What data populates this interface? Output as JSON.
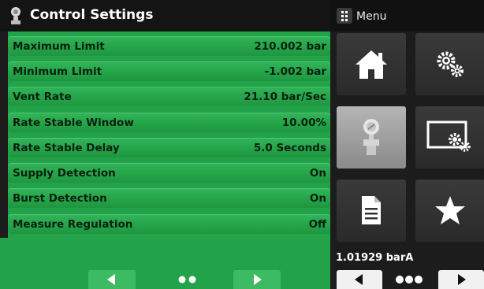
{
  "header": {
    "title": "Control Settings",
    "title_icon": "regulator-icon"
  },
  "settings": [
    {
      "label": "Maximum Limit",
      "value": "210.002 bar"
    },
    {
      "label": "Minimum Limit",
      "value": "-1.002 bar"
    },
    {
      "label": "Vent Rate",
      "value": "21.10 bar/Sec"
    },
    {
      "label": "Rate Stable Window",
      "value": "10.00%"
    },
    {
      "label": "Rate Stable Delay",
      "value": "5.0 Seconds"
    },
    {
      "label": "Supply Detection",
      "value": "On"
    },
    {
      "label": "Burst Detection",
      "value": "On"
    },
    {
      "label": "Measure Regulation",
      "value": "Off"
    }
  ],
  "left_nav": {
    "prev_icon": "arrow-left-icon",
    "next_icon": "arrow-right-icon",
    "page_dots": 2,
    "active_page": 2
  },
  "menu": {
    "label": "Menu",
    "tiles": [
      {
        "name": "home",
        "icon": "home-icon"
      },
      {
        "name": "settings",
        "icon": "gears-icon"
      },
      {
        "name": "control",
        "icon": "regulator-icon",
        "selected": true
      },
      {
        "name": "display-settings",
        "icon": "screen-gear-icon"
      },
      {
        "name": "document",
        "icon": "document-icon"
      },
      {
        "name": "favorites",
        "icon": "star-icon"
      }
    ]
  },
  "reading": "1.01929 barA",
  "right_nav": {
    "page_dots": 3
  },
  "colors": {
    "accent_green": "#22a34a",
    "panel_dark": "#1c1c1c"
  }
}
